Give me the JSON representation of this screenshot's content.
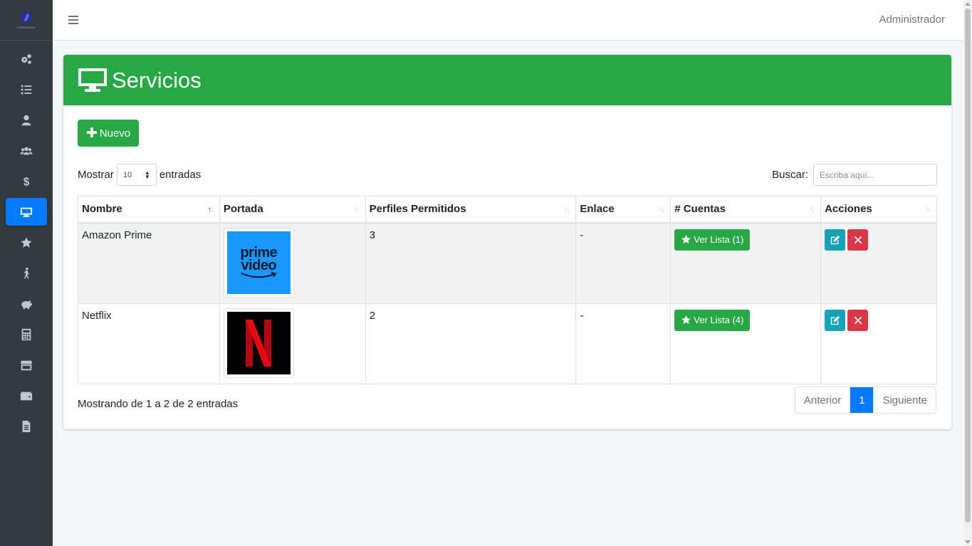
{
  "brand": {
    "logo_text": "STREAMING"
  },
  "sidebar": {
    "items": [
      {
        "icon": "cogs-icon"
      },
      {
        "icon": "list-icon"
      },
      {
        "icon": "user-icon"
      },
      {
        "icon": "users-icon"
      },
      {
        "icon": "dollar-icon"
      },
      {
        "icon": "desktop-icon",
        "active": true
      },
      {
        "icon": "star-icon"
      },
      {
        "icon": "walking-icon"
      },
      {
        "icon": "piggy-bank-icon"
      },
      {
        "icon": "calculator-icon"
      },
      {
        "icon": "store-icon"
      },
      {
        "icon": "wallet-icon"
      },
      {
        "icon": "file-icon"
      }
    ]
  },
  "topbar": {
    "user": "Administrador"
  },
  "page": {
    "title": "Servicios",
    "new_button": "Nuevo",
    "show_label": "Mostrar",
    "show_value": "10",
    "entries_label": "entradas",
    "search_label": "Buscar:",
    "search_placeholder": "Escriba aquí..."
  },
  "table": {
    "headers": [
      "Nombre",
      "Portada",
      "Perfiles Permitidos",
      "Enlace",
      "# Cuentas",
      "Acciones"
    ],
    "rows": [
      {
        "name": "Amazon Prime",
        "cover": "prime video",
        "cover_line1": "prime",
        "cover_line2": "video",
        "profiles": "3",
        "link": "-",
        "accounts": "Ver Lista (1)"
      },
      {
        "name": "Netflix",
        "cover": "netflix",
        "profiles": "2",
        "link": "-",
        "accounts": "Ver Lista (4)"
      }
    ]
  },
  "footer": {
    "info": "Mostrando de 1 a 2 de 2 entradas",
    "prev": "Anterior",
    "page": "1",
    "next": "Siguiente"
  },
  "colors": {
    "primary": "#007bff",
    "success": "#28a745",
    "info": "#17a2b8",
    "danger": "#dc3545",
    "sidebar": "#343a40"
  }
}
